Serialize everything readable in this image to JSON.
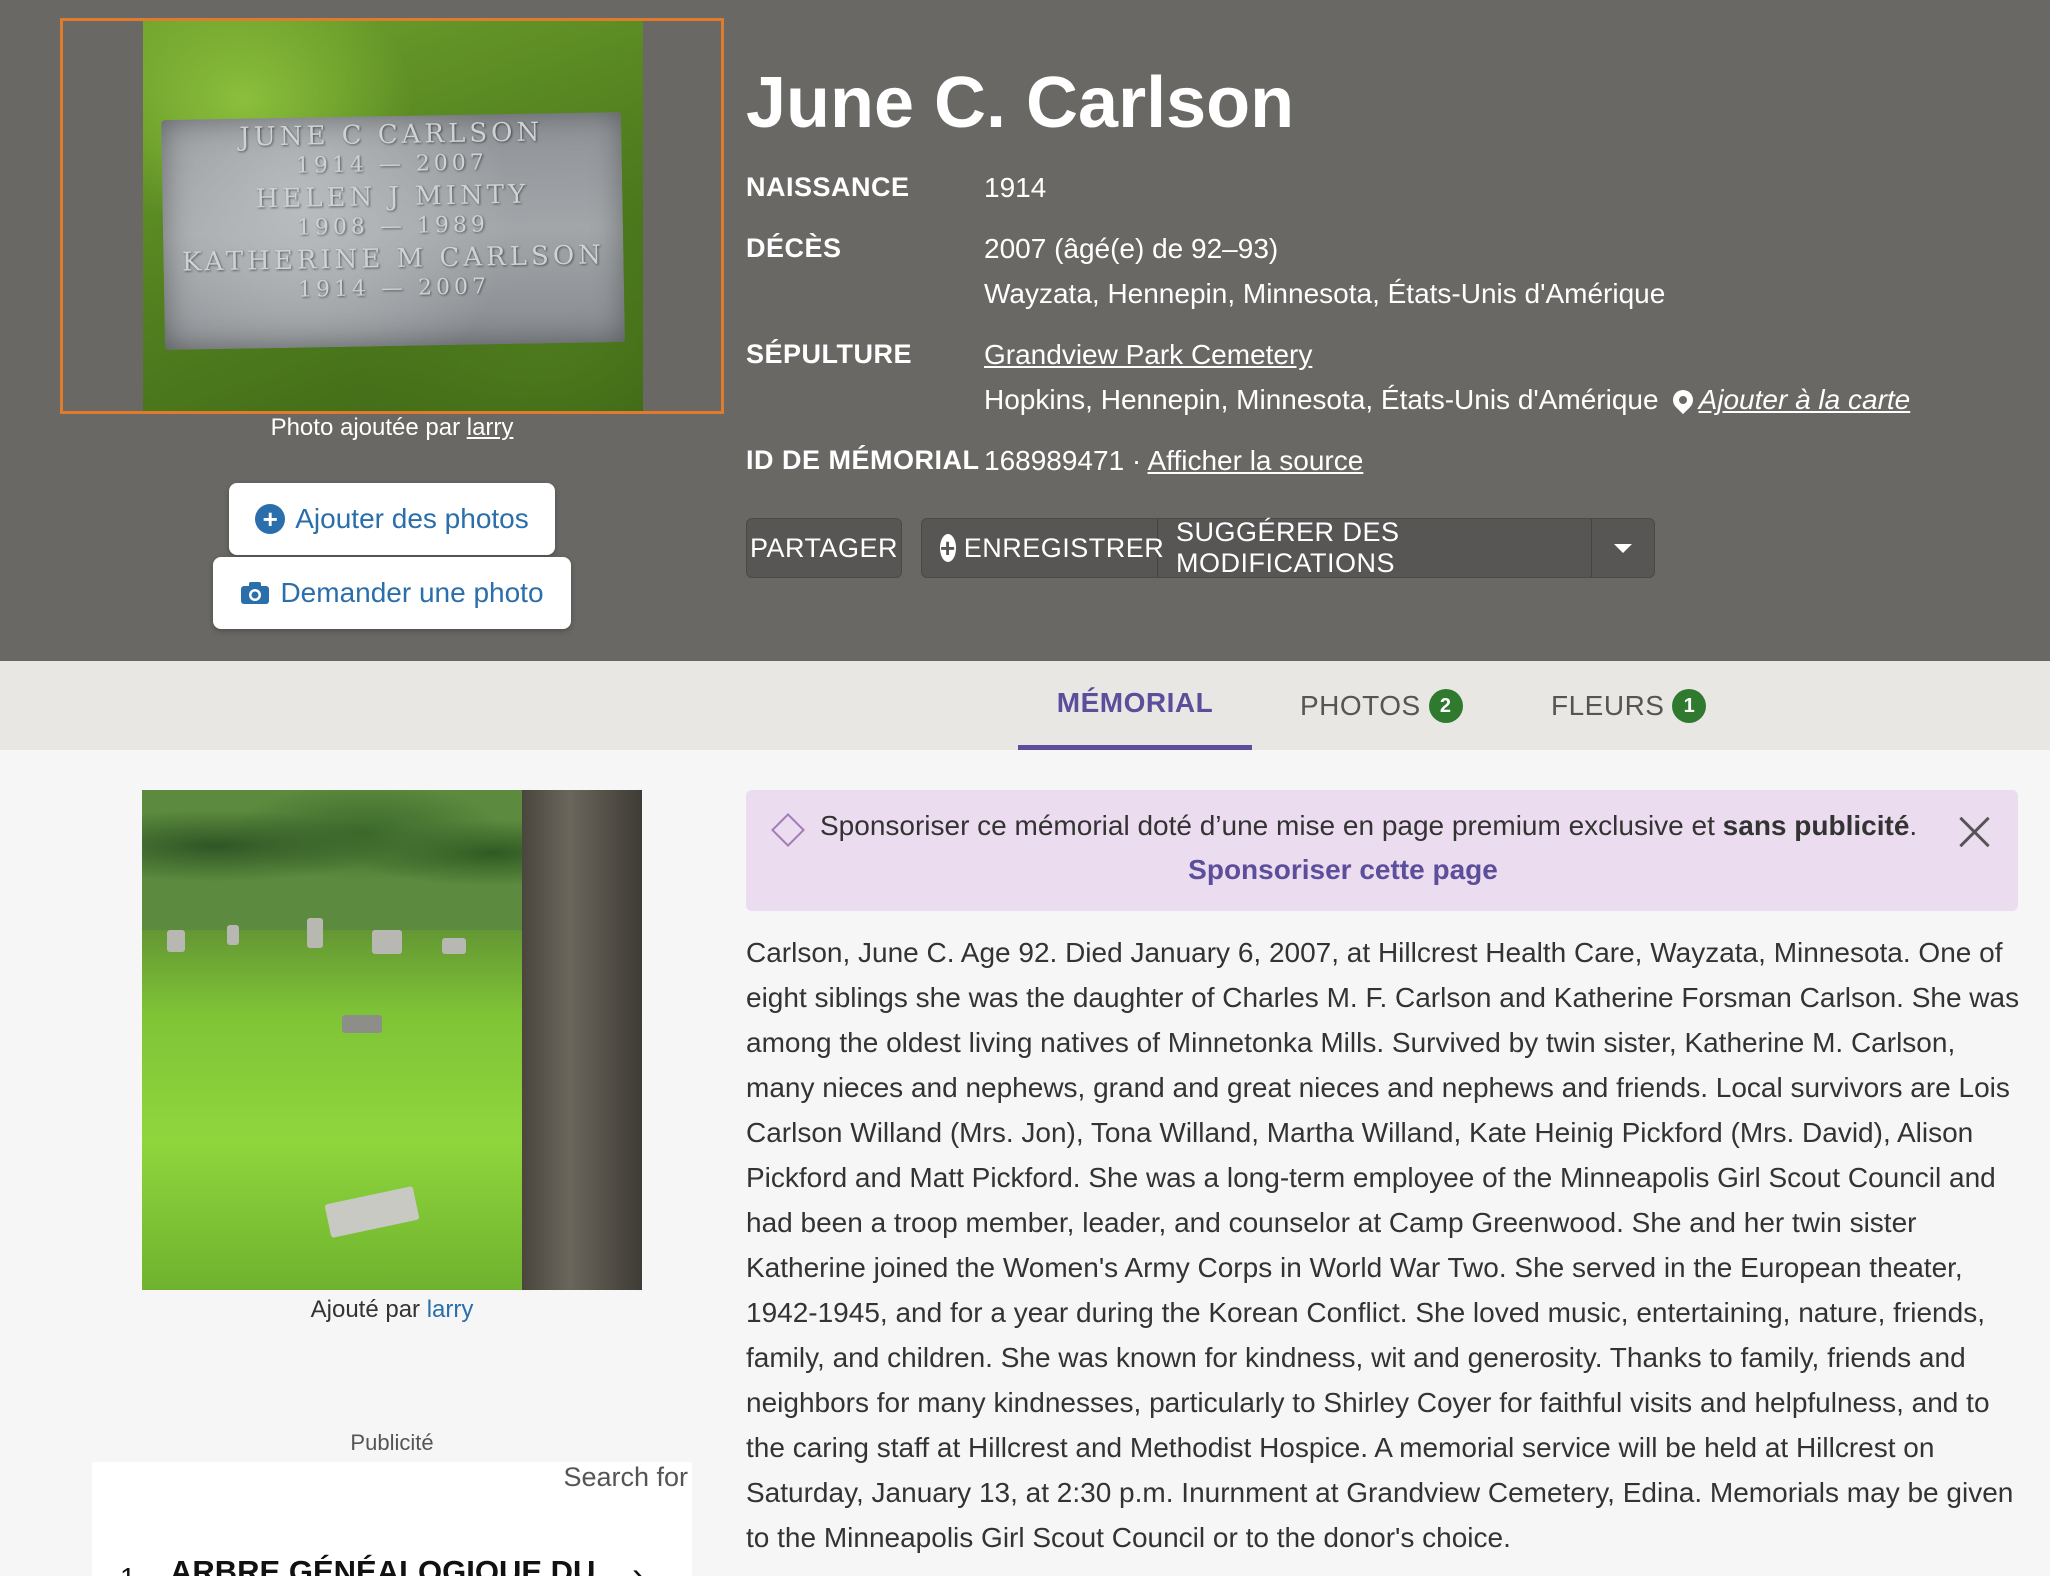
{
  "header": {
    "name": "June C. Carlson",
    "photo_caption_prefix": "Photo ajoutée par ",
    "photo_caption_user": "larry",
    "headstone": {
      "line1": "JUNE C CARLSON",
      "line2": "1914 — 2007",
      "line3": "HELEN J MINTY",
      "line4": "1908 — 1989",
      "line5": "KATHERINE M CARLSON",
      "line6": "1914 — 2007"
    },
    "add_photos_label": "Ajouter des photos",
    "request_photo_label": "Demander une photo"
  },
  "facts": {
    "birth_label": "NAISSANCE",
    "birth_value": "1914",
    "death_label": "DÉCÈS",
    "death_value": "2007 (âgé(e) de 92–93)",
    "death_place": "Wayzata, Hennepin, Minnesota, États-Unis d'Amérique",
    "burial_label": "SÉPULTURE",
    "burial_cemetery": "Grandview Park Cemetery",
    "burial_place": "Hopkins, Hennepin, Minnesota, États-Unis d'Amérique",
    "map_link": "Ajouter à la carte",
    "memorial_id_label": "ID DE MÉMORIAL",
    "memorial_id_value": "168989471 · ",
    "source_link": "Afficher la source"
  },
  "actions": {
    "share": "PARTAGER",
    "save": "ENREGISTRER",
    "suggest": "SUGGÉRER DES MODIFICATIONS"
  },
  "tabs": [
    {
      "label": "MÉMORIAL"
    },
    {
      "label": "PHOTOS",
      "count": "2"
    },
    {
      "label": "FLEURS",
      "count": "1"
    }
  ],
  "side": {
    "caption_prefix": "Ajouté par ",
    "caption_user": "larry",
    "ad_label": "Publicité",
    "ad_search": "Search for",
    "ad_number": "1.",
    "ad_title": "ARBRE GÉNÉALOGIQUE DU"
  },
  "sponsor": {
    "text_prefix": "Sponsoriser ce mémorial doté d’une mise en page premium exclusive et ",
    "text_bold": "sans publicité",
    "text_suffix": ".",
    "link": "Sponsoriser cette page"
  },
  "bio": "Carlson, June C. Age 92. Died January 6, 2007, at Hillcrest Health Care, Wayzata, Minnesota. One of eight siblings she was the daughter of Charles M. F. Carlson and Katherine Forsman Carlson. She was among the oldest living natives of Minnetonka Mills. Survived by twin sister, Katherine M. Carlson, many nieces and nephews, grand and great nieces and nephews and friends. Local survivors are Lois Carlson Willand (Mrs. Jon), Tona Willand, Martha Willand, Kate Heinig Pickford (Mrs. David), Alison Pickford and Matt Pickford. She was a long-term employee of the Minneapolis Girl Scout Council and had been a troop member, leader, and counselor at Camp Greenwood. She and her twin sister Katherine joined the Women's Army Corps in World War Two. She served in the European theater, 1942-1945, and for a year during the Korean Conflict. She loved music, entertaining, nature, friends, family, and children. She was known for kindness, wit and generosity. Thanks to family, friends and neighbors for many kindnesses, particularly to Shirley Coyer for faithful visits and helpfulness, and to the caring staff at Hillcrest and Methodist Hospice. A memorial service will be held at Hillcrest on Saturday, January 13, at 2:30 p.m. Inurnment at Grandview Cemetery, Edina. Memorials may be given to the Minneapolis Girl Scout Council or to the donor's choice."
}
